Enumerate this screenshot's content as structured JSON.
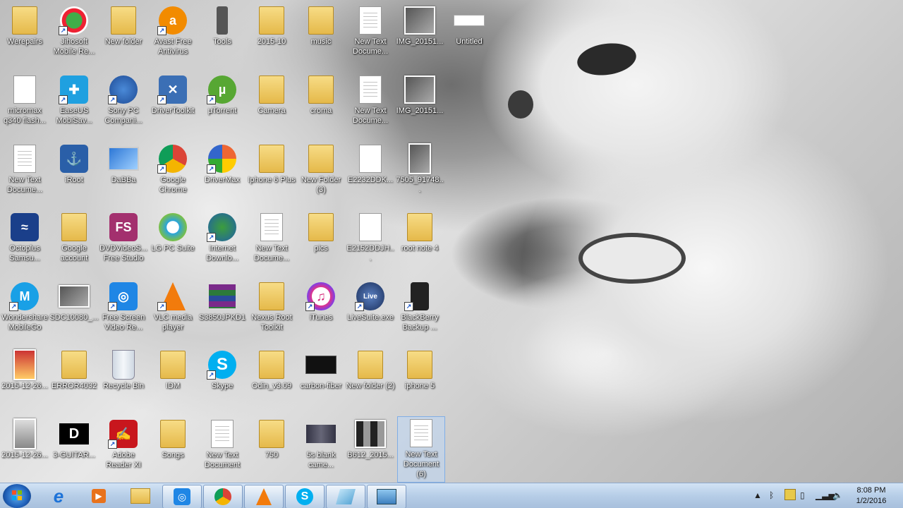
{
  "desktop": {
    "icons": [
      {
        "label": "Werepairs",
        "type": "folder"
      },
      {
        "label": "Jihosoft Mobile Re...",
        "type": "app"
      },
      {
        "label": "New folder",
        "type": "folder"
      },
      {
        "label": "Avast Free Antivirus",
        "type": "app"
      },
      {
        "label": "Tools",
        "type": "app"
      },
      {
        "label": "2015-10",
        "type": "folder"
      },
      {
        "label": "music",
        "type": "folder"
      },
      {
        "label": "New Text Docume...",
        "type": "doc"
      },
      {
        "label": "IMG_20151...",
        "type": "photo"
      },
      {
        "label": "Untitled",
        "type": "photo"
      },
      {
        "label": "micromax q340 flash...",
        "type": "doc"
      },
      {
        "label": "EaseUS MobiSav...",
        "type": "app"
      },
      {
        "label": "Sony PC Compani...",
        "type": "app"
      },
      {
        "label": "DriverToolkit",
        "type": "app"
      },
      {
        "label": "µTorrent",
        "type": "app"
      },
      {
        "label": "Camera",
        "type": "folder"
      },
      {
        "label": "croma",
        "type": "folder"
      },
      {
        "label": "New Text Docume...",
        "type": "doc"
      },
      {
        "label": "IMG_20151...",
        "type": "photo"
      },
      {
        "label": "New Text Docume...",
        "type": "doc"
      },
      {
        "label": "iRoot",
        "type": "app"
      },
      {
        "label": "DaBBa",
        "type": "app"
      },
      {
        "label": "Google Chrome",
        "type": "app"
      },
      {
        "label": "DriverMax",
        "type": "app"
      },
      {
        "label": "Iphone 6 Plus",
        "type": "folder"
      },
      {
        "label": "New Folder (3)",
        "type": "folder"
      },
      {
        "label": "E2232DDK...",
        "type": "doc"
      },
      {
        "label": "7505_91748...",
        "type": "photo"
      },
      {
        "label": "Octoplus Samsu...",
        "type": "app"
      },
      {
        "label": "Google account",
        "type": "folder"
      },
      {
        "label": "DVDVideoS... Free Studio",
        "type": "app"
      },
      {
        "label": "LG PC Suite",
        "type": "app"
      },
      {
        "label": "Internet Downlo...",
        "type": "app"
      },
      {
        "label": "New Text Docume...",
        "type": "doc"
      },
      {
        "label": "pics",
        "type": "folder"
      },
      {
        "label": "E2152DDJH...",
        "type": "doc"
      },
      {
        "label": "root note 4",
        "type": "folder"
      },
      {
        "label": "Wondershare MobileGo",
        "type": "app"
      },
      {
        "label": "SDC10080_...",
        "type": "photo"
      },
      {
        "label": "Free Screen Video Re...",
        "type": "app"
      },
      {
        "label": "VLC media player",
        "type": "app"
      },
      {
        "label": "S3850JPKD1",
        "type": "app"
      },
      {
        "label": "Nexus Root Toolkit",
        "type": "folder"
      },
      {
        "label": "iTunes",
        "type": "app"
      },
      {
        "label": "LiveSuite.exe",
        "type": "app"
      },
      {
        "label": "BlackBerry Backup ...",
        "type": "app"
      },
      {
        "label": "2015-12-26...",
        "type": "photo"
      },
      {
        "label": "ERROR4032",
        "type": "folder"
      },
      {
        "label": "Recycle Bin",
        "type": "app"
      },
      {
        "label": "IDM",
        "type": "folder"
      },
      {
        "label": "Skype",
        "type": "app"
      },
      {
        "label": "Odin_v3.09",
        "type": "folder"
      },
      {
        "label": "carbon-fiber",
        "type": "photo"
      },
      {
        "label": "New folder (2)",
        "type": "folder"
      },
      {
        "label": "iphone 5",
        "type": "folder"
      },
      {
        "label": "2015-12-26...",
        "type": "photo"
      },
      {
        "label": "3-GUITAR...",
        "type": "photo"
      },
      {
        "label": "Adobe Reader XI",
        "type": "app"
      },
      {
        "label": "Songs",
        "type": "folder"
      },
      {
        "label": "New Text Document",
        "type": "doc"
      },
      {
        "label": "750",
        "type": "folder"
      },
      {
        "label": "5s blank came...",
        "type": "photo"
      },
      {
        "label": "B612_2015...",
        "type": "photo"
      },
      {
        "label": "New Text Document (6)",
        "type": "doc"
      }
    ]
  },
  "taskbar": {
    "items": [
      "start",
      "internet-explorer",
      "media-player",
      "file-explorer",
      "screen-recorder",
      "google-chrome",
      "vlc",
      "skype",
      "unknown-app",
      "image-viewer"
    ],
    "clock": {
      "time": "8:08 PM",
      "date": "1/2/2016"
    }
  },
  "app_tiles": {
    "dvd": "FS",
    "guitar": "D"
  }
}
